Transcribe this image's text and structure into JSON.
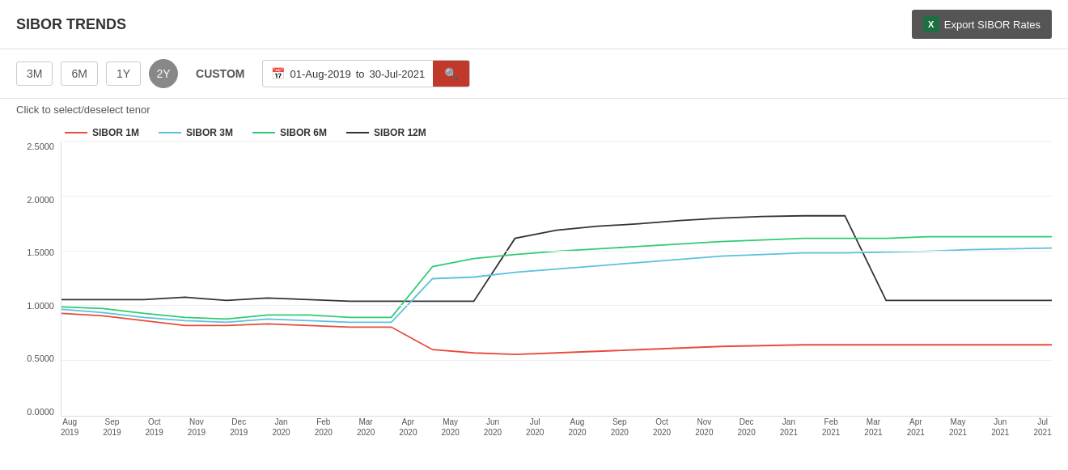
{
  "header": {
    "title": "SIBOR TRENDS",
    "export_label": "Export SIBOR Rates"
  },
  "toolbar": {
    "period_buttons": [
      "3M",
      "6M",
      "1Y",
      "2Y"
    ],
    "active_period": "2Y",
    "custom_label": "CUSTOM",
    "date_from": "01-Aug-2019",
    "date_to": "30-Jul-2021",
    "date_separator": "to"
  },
  "chart": {
    "hint": "Click to select/deselect tenor",
    "legend": [
      {
        "label": "SIBOR 1M",
        "color": "#e74c3c"
      },
      {
        "label": "SIBOR 3M",
        "color": "#5bc0de"
      },
      {
        "label": "SIBOR 6M",
        "color": "#2ecc71"
      },
      {
        "label": "SIBOR 12M",
        "color": "#333333"
      }
    ],
    "y_labels": [
      "0.0000",
      "0.5000",
      "1.0000",
      "1.5000",
      "2.0000",
      "2.5000"
    ],
    "x_labels": [
      {
        "line1": "Aug",
        "line2": "2019"
      },
      {
        "line1": "Sep",
        "line2": "2019"
      },
      {
        "line1": "Oct",
        "line2": "2019"
      },
      {
        "line1": "Nov",
        "line2": "2019"
      },
      {
        "line1": "Dec",
        "line2": "2019"
      },
      {
        "line1": "Jan",
        "line2": "2020"
      },
      {
        "line1": "Feb",
        "line2": "2020"
      },
      {
        "line1": "Mar",
        "line2": "2020"
      },
      {
        "line1": "Apr",
        "line2": "2020"
      },
      {
        "line1": "May",
        "line2": "2020"
      },
      {
        "line1": "Jun",
        "line2": "2020"
      },
      {
        "line1": "Jul",
        "line2": "2020"
      },
      {
        "line1": "Aug",
        "line2": "2020"
      },
      {
        "line1": "Sep",
        "line2": "2020"
      },
      {
        "line1": "Oct",
        "line2": "2020"
      },
      {
        "line1": "Nov",
        "line2": "2020"
      },
      {
        "line1": "Dec",
        "line2": "2020"
      },
      {
        "line1": "Jan",
        "line2": "2021"
      },
      {
        "line1": "Feb",
        "line2": "2021"
      },
      {
        "line1": "Mar",
        "line2": "2021"
      },
      {
        "line1": "Apr",
        "line2": "2021"
      },
      {
        "line1": "May",
        "line2": "2021"
      },
      {
        "line1": "Jun",
        "line2": "2021"
      },
      {
        "line1": "Jul",
        "line2": "2021"
      }
    ]
  }
}
